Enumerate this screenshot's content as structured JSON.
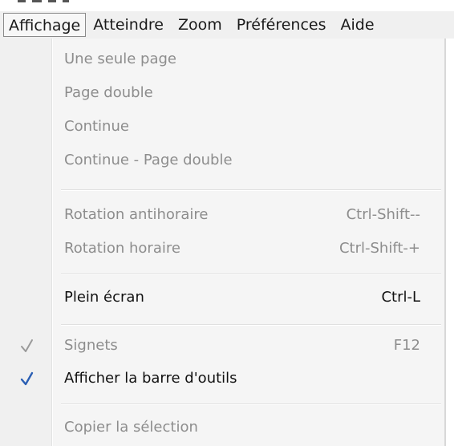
{
  "menubar": {
    "items": [
      {
        "label": "Affichage",
        "active": true
      },
      {
        "label": "Atteindre",
        "active": false
      },
      {
        "label": "Zoom",
        "active": false
      },
      {
        "label": "Préférences",
        "active": false
      },
      {
        "label": "Aide",
        "active": false
      }
    ]
  },
  "menu": {
    "items": [
      {
        "label": "Une seule page",
        "shortcut": "",
        "enabled": false,
        "checked": false
      },
      {
        "label": "Page double",
        "shortcut": "",
        "enabled": false,
        "checked": false
      },
      {
        "label": "Continue",
        "shortcut": "",
        "enabled": false,
        "checked": false
      },
      {
        "label": "Continue - Page double",
        "shortcut": "",
        "enabled": false,
        "checked": false
      },
      {
        "label": "Rotation antihoraire",
        "shortcut": "Ctrl-Shift--",
        "enabled": false,
        "checked": false
      },
      {
        "label": "Rotation horaire",
        "shortcut": "Ctrl-Shift-+",
        "enabled": false,
        "checked": false
      },
      {
        "label": "Plein écran",
        "shortcut": "Ctrl-L",
        "enabled": true,
        "checked": false
      },
      {
        "label": "Signets",
        "shortcut": "F12",
        "enabled": false,
        "checked": true
      },
      {
        "label": "Afficher la barre d'outils",
        "shortcut": "",
        "enabled": true,
        "checked": true
      },
      {
        "label": "Copier la sélection",
        "shortcut": "",
        "enabled": false,
        "checked": false
      }
    ]
  },
  "colors": {
    "check_enabled": "#2b5fb4",
    "check_disabled": "#9a9a9a",
    "text_disabled": "#8d8d8d",
    "text_enabled": "#111111"
  },
  "icons": {
    "check": "checkmark-icon"
  }
}
